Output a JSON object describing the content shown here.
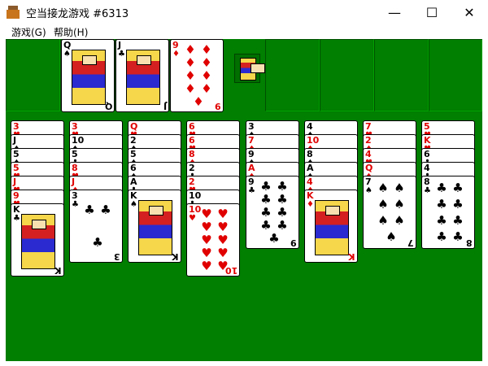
{
  "window": {
    "title": "空当接龙游戏 #6313",
    "minimize_label": "—",
    "maximize_label": "☐",
    "close_label": "✕"
  },
  "menu": [
    {
      "label": "游戏(G)"
    },
    {
      "label": "帮助(H)"
    }
  ],
  "colors": {
    "felt": "#007f00",
    "red_suit": "#e00000",
    "black_suit": "#000000"
  },
  "free_cells": [
    {
      "rank": "Q",
      "suit": "♠"
    },
    {
      "rank": "J",
      "suit": "♣"
    },
    {
      "rank": "9",
      "suit": "♦"
    },
    {
      "rank": "",
      "suit": ""
    }
  ],
  "foundations": [
    {
      "rank": "",
      "suit": ""
    },
    {
      "rank": "",
      "suit": ""
    },
    {
      "rank": "",
      "suit": ""
    },
    {
      "rank": "",
      "suit": ""
    }
  ],
  "king_icon": "king-face-icon",
  "tableau": [
    [
      {
        "rank": "3",
        "suit": "♥"
      },
      {
        "rank": "J",
        "suit": "♠"
      },
      {
        "rank": "5",
        "suit": "♠"
      },
      {
        "rank": "5",
        "suit": "♥"
      },
      {
        "rank": "J",
        "suit": "♥"
      },
      {
        "rank": "9",
        "suit": "♥"
      },
      {
        "rank": "K",
        "suit": "♣"
      }
    ],
    [
      {
        "rank": "3",
        "suit": "♥"
      },
      {
        "rank": "10",
        "suit": "♠"
      },
      {
        "rank": "5",
        "suit": "♣"
      },
      {
        "rank": "8",
        "suit": "♥"
      },
      {
        "rank": "J",
        "suit": "♦"
      },
      {
        "rank": "3",
        "suit": "♣"
      }
    ],
    [
      {
        "rank": "Q",
        "suit": "♥"
      },
      {
        "rank": "2",
        "suit": "♠"
      },
      {
        "rank": "5",
        "suit": "♠"
      },
      {
        "rank": "6",
        "suit": "♠"
      },
      {
        "rank": "A",
        "suit": "♣"
      },
      {
        "rank": "K",
        "suit": "♠"
      }
    ],
    [
      {
        "rank": "6",
        "suit": "♥"
      },
      {
        "rank": "6",
        "suit": "♥"
      },
      {
        "rank": "8",
        "suit": "♦"
      },
      {
        "rank": "2",
        "suit": "♣"
      },
      {
        "rank": "2",
        "suit": "♥"
      },
      {
        "rank": "10",
        "suit": "♣"
      },
      {
        "rank": "10",
        "suit": "♥"
      }
    ],
    [
      {
        "rank": "3",
        "suit": "♠"
      },
      {
        "rank": "7",
        "suit": "♦"
      },
      {
        "rank": "9",
        "suit": "♠"
      },
      {
        "rank": "A",
        "suit": "♦"
      },
      {
        "rank": "9",
        "suit": "♣"
      }
    ],
    [
      {
        "rank": "4",
        "suit": "♠"
      },
      {
        "rank": "10",
        "suit": "♦"
      },
      {
        "rank": "8",
        "suit": "♠"
      },
      {
        "rank": "A",
        "suit": "♠"
      },
      {
        "rank": "4",
        "suit": "♦"
      },
      {
        "rank": "K",
        "suit": "♦"
      }
    ],
    [
      {
        "rank": "7",
        "suit": "♥"
      },
      {
        "rank": "2",
        "suit": "♦"
      },
      {
        "rank": "4",
        "suit": "♥"
      },
      {
        "rank": "Q",
        "suit": "♦"
      },
      {
        "rank": "7",
        "suit": "♠"
      }
    ],
    [
      {
        "rank": "5",
        "suit": "♥"
      },
      {
        "rank": "K",
        "suit": "♥"
      },
      {
        "rank": "6",
        "suit": "♣"
      },
      {
        "rank": "4",
        "suit": "♣"
      },
      {
        "rank": "8",
        "suit": "♣"
      }
    ]
  ]
}
